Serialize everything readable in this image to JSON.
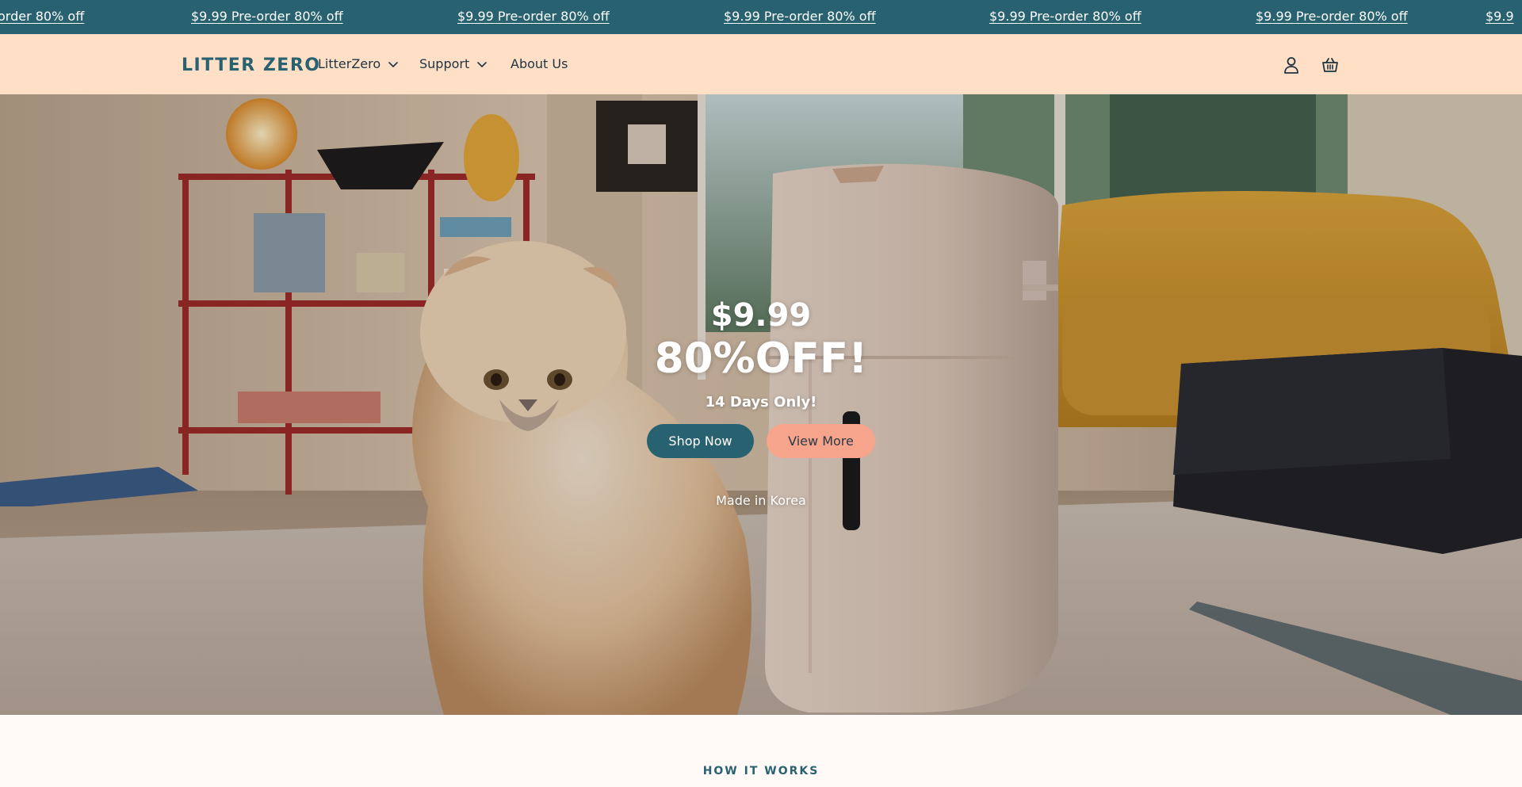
{
  "announcement": {
    "items": [
      "order 80% off",
      "$9.99 Pre-order 80% off",
      "$9.99 Pre-order 80% off",
      "$9.99 Pre-order 80% off",
      "$9.99 Pre-order 80% off",
      "$9.99 Pre-order 80% off",
      "$9.9"
    ],
    "background": "#28616f"
  },
  "header": {
    "logo": "LITTER ZERO",
    "nav": [
      {
        "label": "LitterZero",
        "has_dropdown": true
      },
      {
        "label": "Support",
        "has_dropdown": true
      },
      {
        "label": "About Us",
        "has_dropdown": false
      }
    ],
    "icons": [
      "account-icon",
      "cart-icon"
    ],
    "background": "#ffdfc5"
  },
  "hero": {
    "price": "$9.99",
    "discount": "80%OFF!",
    "subtitle": "14 Days Only!",
    "primary_button": "Shop Now",
    "secondary_button": "View More",
    "footnote": "Made in Korea",
    "colors": {
      "primary_button": "#28616f",
      "secondary_button": "#f6a48c"
    }
  },
  "how_it_works": {
    "title": "HOW IT WORKS"
  }
}
